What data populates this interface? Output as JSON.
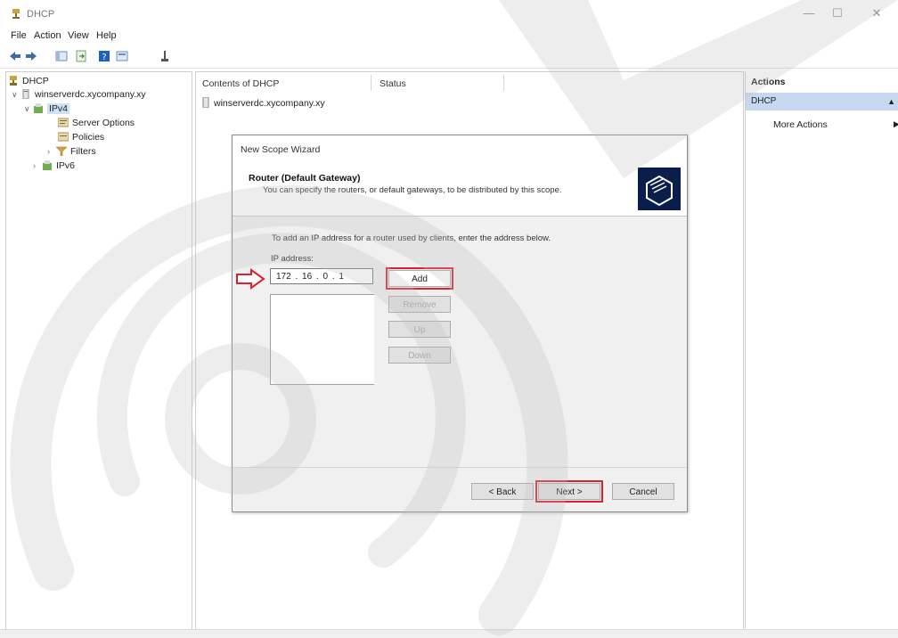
{
  "window": {
    "title": "DHCP",
    "minimize": "—",
    "maximize": "☐",
    "close": "✕"
  },
  "menu": [
    "File",
    "Action",
    "View",
    "Help"
  ],
  "toolbar_icons": [
    "back-arrow-icon",
    "forward-arrow-icon",
    "show-pane-icon",
    "export-icon",
    "help-icon",
    "console-icon",
    "plug-icon"
  ],
  "tree": {
    "root": "DHCP",
    "server": "winserverdc.xycompany.xy",
    "ipv4": "IPv4",
    "server_options": "Server Options",
    "policies": "Policies",
    "filters": "Filters",
    "ipv6": "IPv6"
  },
  "content": {
    "col_contents": "Contents of DHCP",
    "col_status": "Status",
    "row_server": "winserverdc.xycompany.xy"
  },
  "wizard": {
    "title": "New Scope Wizard",
    "heading": "Router (Default Gateway)",
    "subheading": "You can specify the routers, or default gateways, to be distributed by this scope.",
    "instruction": "To add an IP address for a router used by clients, enter the address below.",
    "ip_label": "IP address:",
    "ip_value": "172 . 16 . 0 . 1",
    "buttons": {
      "add": "Add",
      "remove": "Remove",
      "up": "Up",
      "down": "Down"
    },
    "footer": {
      "back": "< Back",
      "next": "Next >",
      "cancel": "Cancel"
    }
  },
  "actions": {
    "header": "Actions",
    "section": "DHCP",
    "more": "More Actions"
  },
  "colors": {
    "highlight": "#d9232e",
    "selection": "#c5d8ef",
    "wizard_icon_bg": "#0b1e4a"
  }
}
